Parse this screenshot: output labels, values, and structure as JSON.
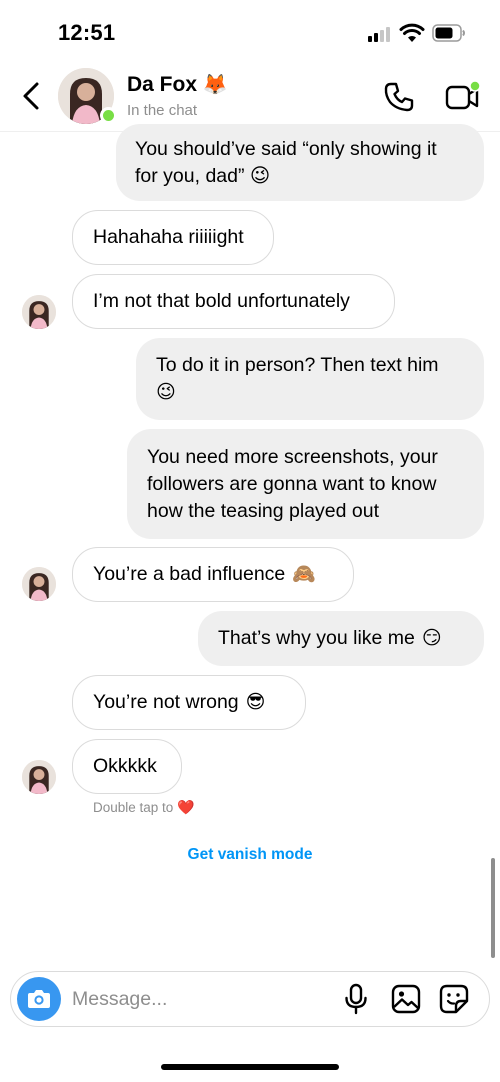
{
  "status_bar": {
    "time": "12:51"
  },
  "header": {
    "contact_name": "Da Fox",
    "contact_emoji": "🦊",
    "contact_status": "In the chat",
    "icons": [
      "back-chevron-icon",
      "phone-icon",
      "video-camera-icon"
    ],
    "online_color": "#78de45"
  },
  "messages": [
    {
      "sender": "me",
      "lines": [
        "You should’ve said “only showing it",
        "for you, dad” 😉"
      ]
    },
    {
      "sender": "them",
      "text": "Hahahaha riiiiight"
    },
    {
      "sender": "them",
      "text": "I’m not that bold unfortunately"
    },
    {
      "sender": "me",
      "lines": [
        "To do it in person? Then text him",
        "😉"
      ]
    },
    {
      "sender": "me",
      "lines": [
        "You need more screenshots, your",
        "followers are gonna want to know",
        "how the teasing played out"
      ]
    },
    {
      "sender": "them",
      "text": "You’re a bad influence",
      "emoji": "🙈"
    },
    {
      "sender": "me",
      "text": "That’s why you like me",
      "emoji": "😏"
    },
    {
      "sender": "them",
      "text": "You’re not wrong",
      "emoji": "😎"
    },
    {
      "sender": "them",
      "text": "Okkkkk"
    }
  ],
  "double_tap_hint": "Double tap to",
  "double_tap_emoji": "❤️",
  "vanish_mode_label": "Get vanish mode",
  "composer": {
    "placeholder": "Message...",
    "icons": [
      "camera-icon",
      "microphone-icon",
      "gallery-icon",
      "sticker-icon"
    ]
  },
  "colors": {
    "accent": "#0095f6",
    "camera_button": "#3897f0",
    "outgoing_bubble": "#efefef",
    "secondary_text": "#8e8e8e"
  }
}
